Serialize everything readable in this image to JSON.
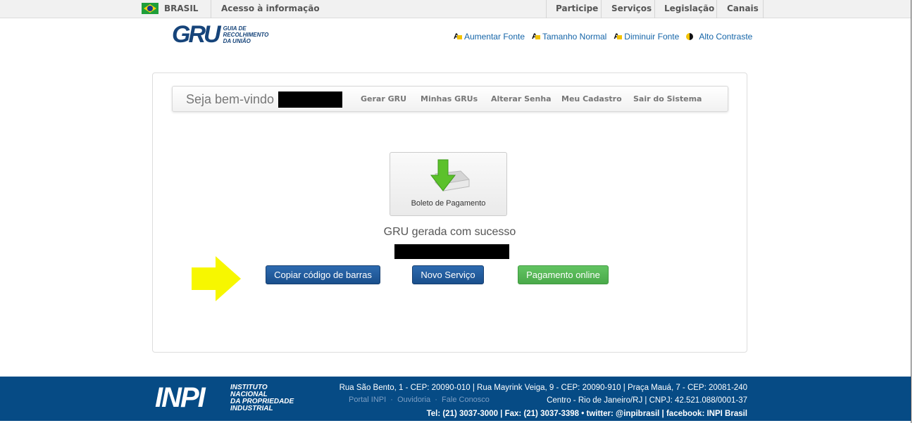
{
  "topbar": {
    "country": "BRASIL",
    "access_info": "Acesso à informação",
    "items": [
      "Participe",
      "Serviços",
      "Legislação",
      "Canais"
    ]
  },
  "logo": {
    "text": "GRU",
    "subtitle": [
      "GUIA DE",
      "RECOLHIMENTO",
      "DA UNIÃO"
    ]
  },
  "accessibility": {
    "increase": "Aumentar Fonte",
    "normal": "Tamanho Normal",
    "decrease": "Diminuir Fonte",
    "contrast": "Alto Contraste"
  },
  "nav": {
    "welcome": "Seja bem-vindo",
    "links": [
      "Gerar GRU",
      "Minhas GRUs",
      "Alterar Senha",
      "Meu Cadastro",
      "Sair do Sistema"
    ]
  },
  "main": {
    "boleto_label": "Boleto de Pagamento",
    "success_message": "GRU gerada com sucesso",
    "buttons": {
      "copy": "Copiar código de barras",
      "new": "Novo Serviço",
      "pay": "Pagamento online"
    }
  },
  "footer": {
    "logo": "INPI",
    "logo_sub": [
      "INSTITUTO",
      "NACIONAL",
      "DA PROPRIEDADE",
      "INDUSTRIAL"
    ],
    "address": "Rua São Bento, 1 - CEP: 20090-010 | Rua Mayrink Veiga, 9 - CEP: 20090-910 | Praça Mauá, 7 - CEP: 20081-240",
    "links": [
      "Portal INPI",
      "Ouvidoria",
      "Fale Conosco"
    ],
    "city": "Centro - Rio de Janeiro/RJ | CNPJ: 42.521.088/0001-37",
    "contact": "Tel: (21) 3037-3000 | Fax: (21) 3037-3398 • twitter: @inpibrasil | facebook: INPI Brasil"
  }
}
